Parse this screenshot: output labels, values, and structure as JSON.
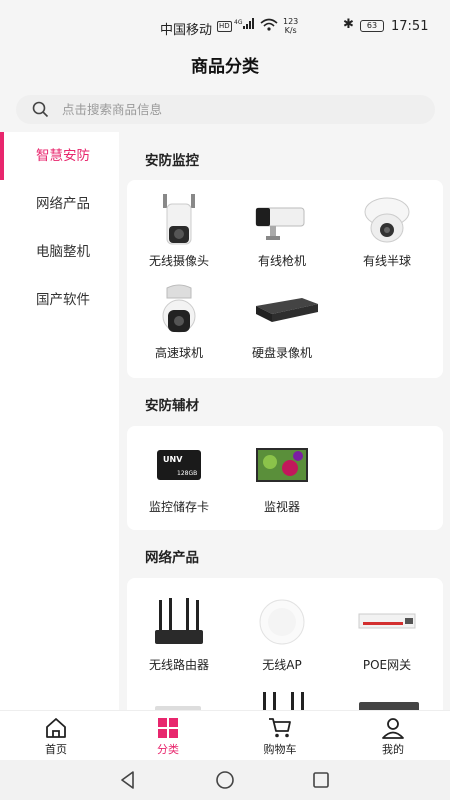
{
  "status_bar": {
    "carrier": "中国移动",
    "hd": "HD",
    "network": "4G",
    "speed_value": "123",
    "speed_unit": "K/s",
    "battery": "63",
    "time": "17:51"
  },
  "header": {
    "title": "商品分类"
  },
  "search": {
    "placeholder": "点击搜索商品信息"
  },
  "sidebar": {
    "items": [
      {
        "label": "智慧安防",
        "active": true
      },
      {
        "label": "网络产品",
        "active": false
      },
      {
        "label": "电脑整机",
        "active": false
      },
      {
        "label": "国产软件",
        "active": false
      }
    ]
  },
  "sections": [
    {
      "title": "安防监控",
      "products": [
        {
          "label": "无线摄像头",
          "icon": "wireless-camera"
        },
        {
          "label": "有线枪机",
          "icon": "bullet-camera"
        },
        {
          "label": "有线半球",
          "icon": "dome-camera"
        },
        {
          "label": "高速球机",
          "icon": "ptz-camera"
        },
        {
          "label": "硬盘录像机",
          "icon": "nvr"
        }
      ]
    },
    {
      "title": "安防辅材",
      "products": [
        {
          "label": "监控储存卡",
          "icon": "sd-card",
          "icon_text": "UNV",
          "icon_text2": "128GB"
        },
        {
          "label": "监视器",
          "icon": "monitor"
        }
      ]
    },
    {
      "title": "网络产品",
      "products": [
        {
          "label": "无线路由器",
          "icon": "router"
        },
        {
          "label": "无线AP",
          "icon": "ap"
        },
        {
          "label": "POE网关",
          "icon": "poe-switch"
        }
      ]
    }
  ],
  "tabbar": {
    "tabs": [
      {
        "label": "首页",
        "icon": "home-icon",
        "active": false
      },
      {
        "label": "分类",
        "icon": "category-icon",
        "active": true
      },
      {
        "label": "购物车",
        "icon": "cart-icon",
        "active": false
      },
      {
        "label": "我的",
        "icon": "user-icon",
        "active": false
      }
    ]
  },
  "colors": {
    "accent": "#e8266d",
    "page_bg": "#f5f5f5"
  }
}
